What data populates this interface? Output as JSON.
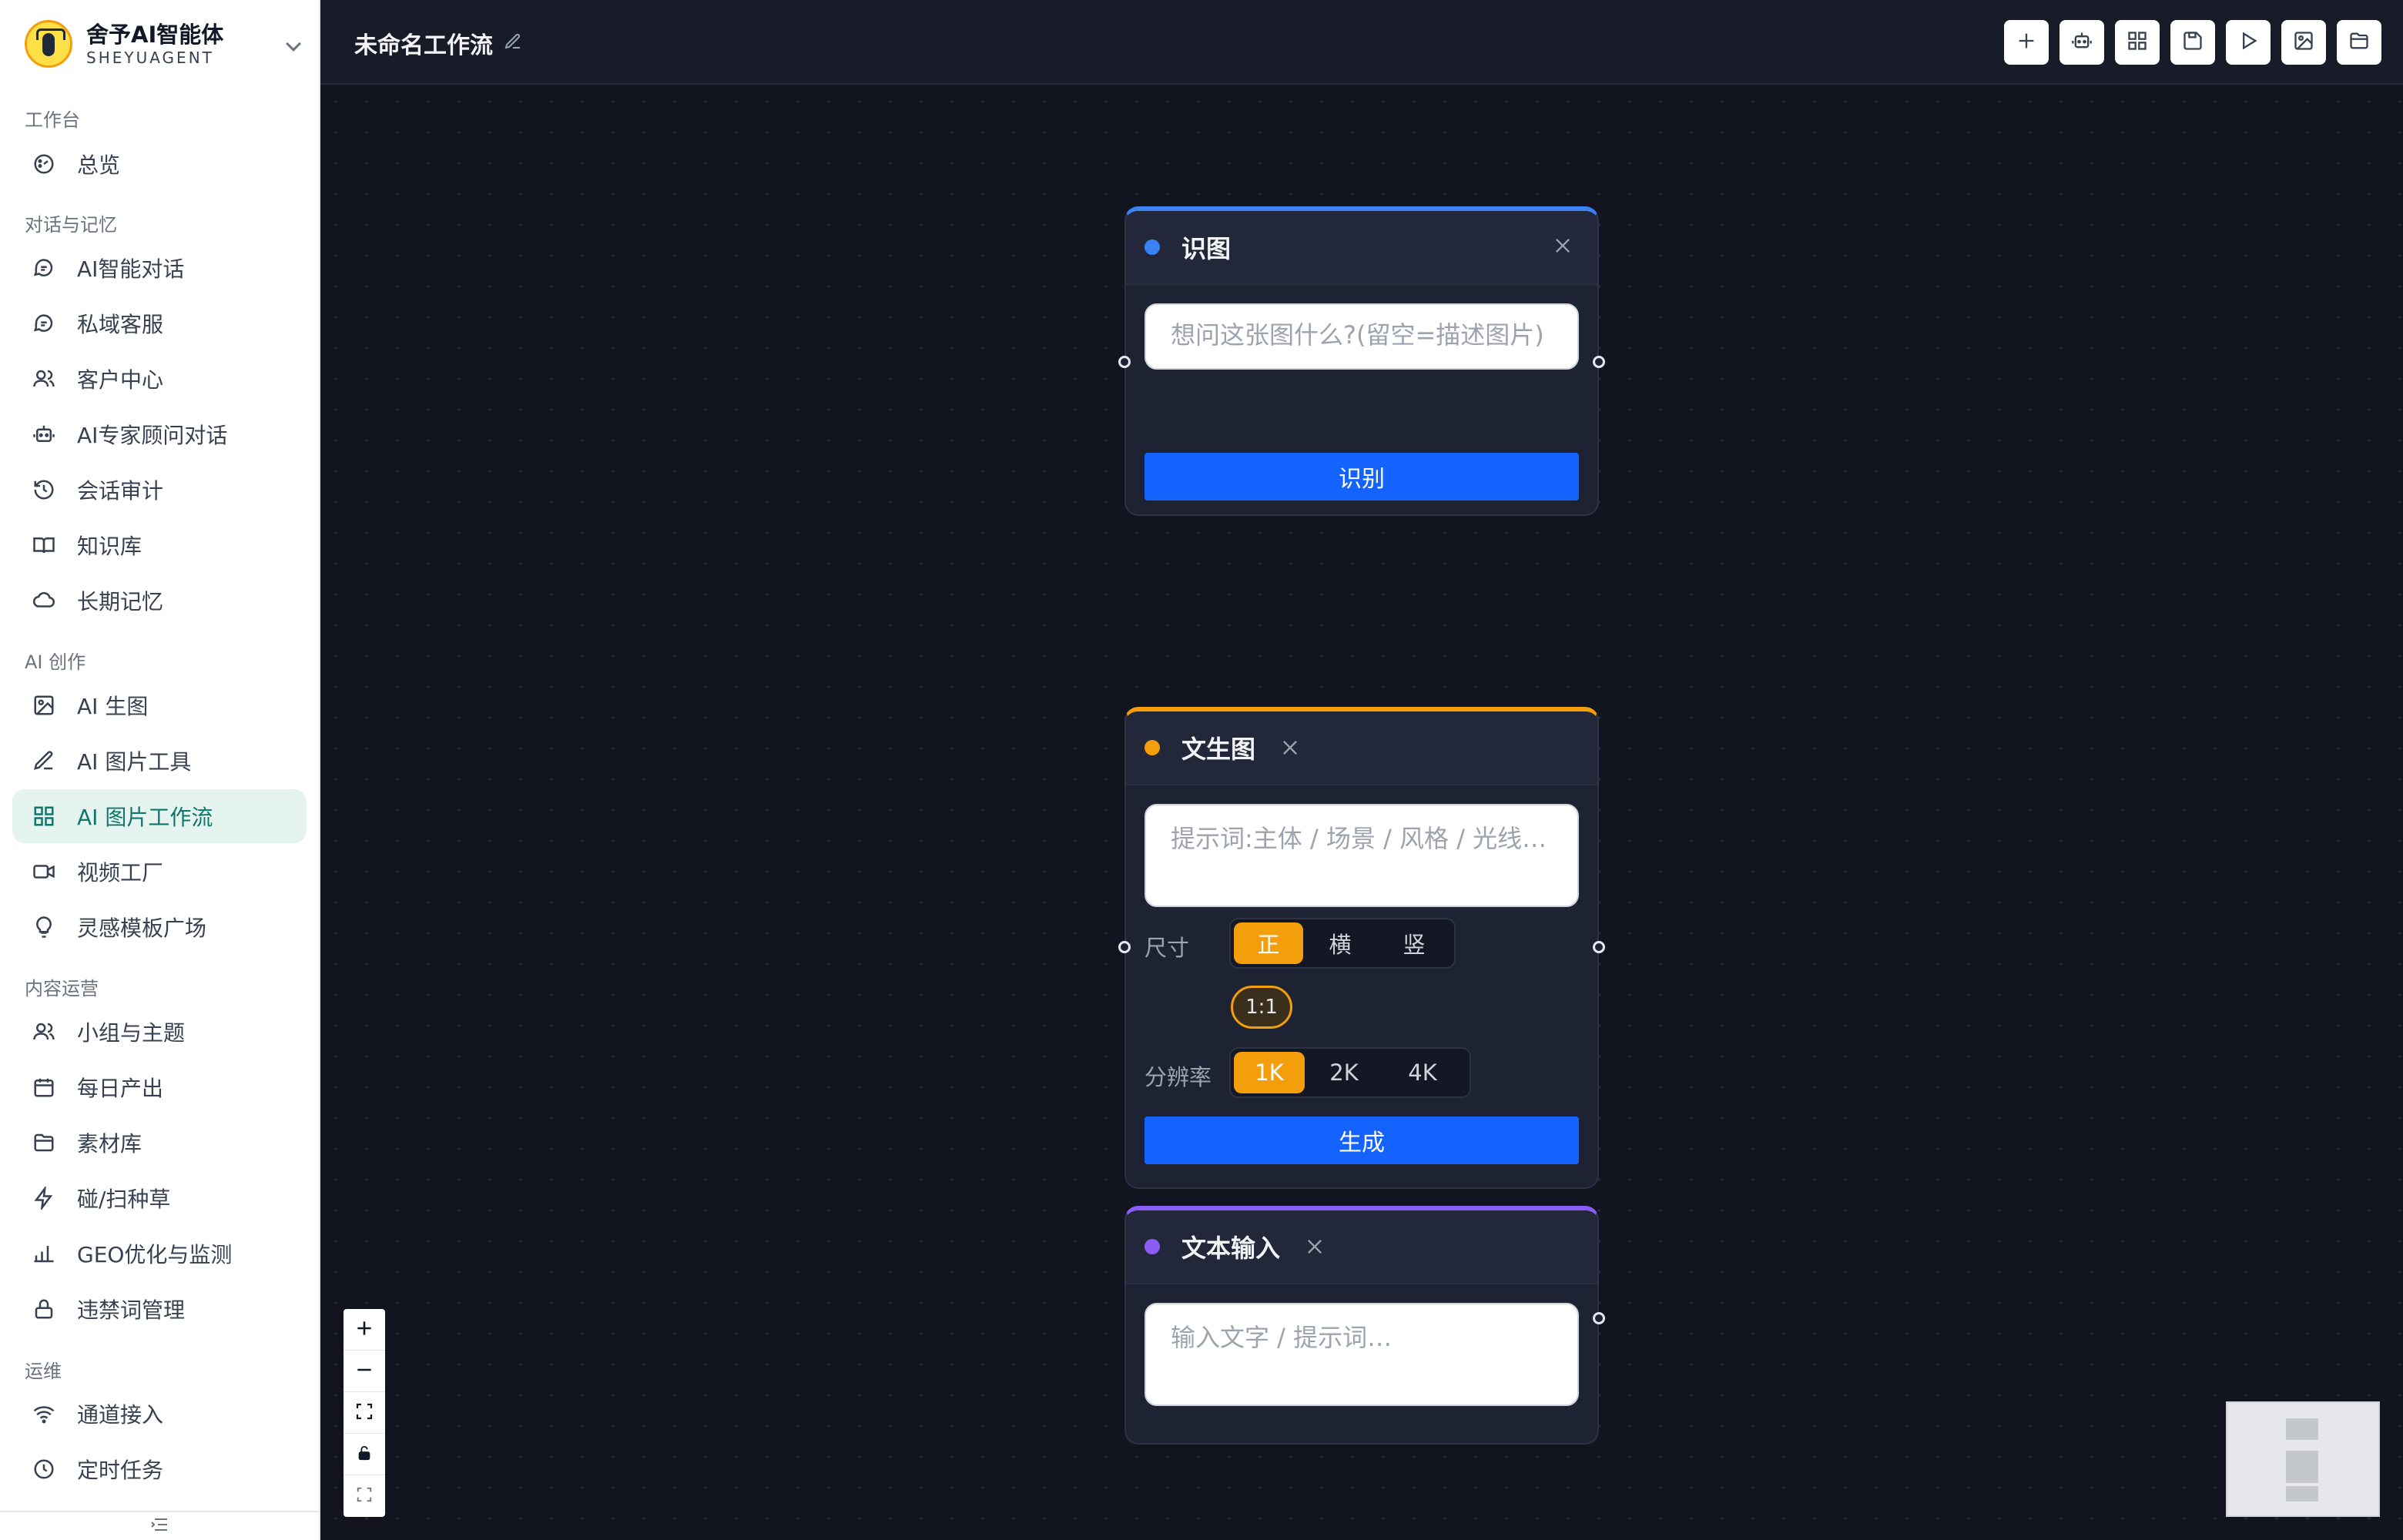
{
  "brand": {
    "name": "舍予AI智能体",
    "sub": "SHEYUAGENT"
  },
  "sidebar": {
    "sections": {
      "workbench": "工作台",
      "chat": "对话与记忆",
      "create": "AI 创作",
      "content": "内容运营",
      "ops": "运维"
    },
    "items": {
      "overview": "总览",
      "ai_chat": "AI智能对话",
      "private_service": "私域客服",
      "customer_center": "客户中心",
      "expert_chat": "AI专家顾问对话",
      "session_audit": "会话审计",
      "knowledge": "知识库",
      "long_memory": "长期记忆",
      "ai_image": "AI 生图",
      "image_tools": "AI 图片工具",
      "image_workflow": "AI 图片工作流",
      "video_factory": "视频工厂",
      "inspiration": "灵感模板广场",
      "groups_topics": "小组与主题",
      "daily_output": "每日产出",
      "assets": "素材库",
      "seeding": "碰/扫种草",
      "geo": "GEO优化与监测",
      "banned_words": "违禁词管理",
      "channels": "通道接入",
      "scheduled": "定时任务"
    },
    "active": "image_workflow"
  },
  "workflow": {
    "title": "未命名工作流"
  },
  "toolbar": [
    "plus-icon",
    "robot-icon",
    "grid-icon",
    "save-icon",
    "play-icon",
    "image-icon",
    "folder-icon"
  ],
  "nodes": {
    "recognize": {
      "title": "识图",
      "color": "#3b82f6",
      "placeholder": "想问这张图什么?(留空=描述图片)",
      "button": "识别"
    },
    "text_to_image": {
      "title": "文生图",
      "color": "#f59e0b",
      "placeholder": "提示词:主体 / 场景 / 风格 / 光线…",
      "size_label": "尺寸",
      "size_options": [
        "正",
        "横",
        "竖"
      ],
      "size_selected": "正",
      "ratio": "1:1",
      "res_label": "分辨率",
      "res_options": [
        "1K",
        "2K",
        "4K"
      ],
      "res_selected": "1K",
      "button": "生成"
    },
    "text_input": {
      "title": "文本输入",
      "color": "#8b5cf6",
      "placeholder": "输入文字 / 提示词…"
    }
  },
  "colors": {
    "accent": "#1463ff",
    "active_nav": "#0f766e",
    "canvas": "#12151f"
  }
}
